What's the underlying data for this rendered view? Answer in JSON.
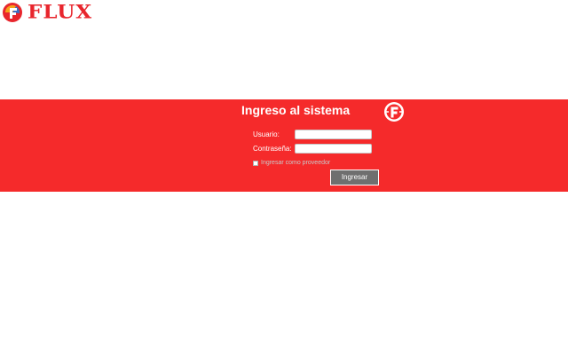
{
  "brand": {
    "name": "FLUX",
    "color": "#e8262d"
  },
  "colors": {
    "band": "#f52a2b",
    "button": "#6f6f6f"
  },
  "login": {
    "title": "Ingreso al sistema",
    "username_label": "Usuario:",
    "username_value": "",
    "password_label": "Contraseña:",
    "password_value": "",
    "provider_checkbox_label": "Ingresar como proveedor",
    "provider_checked": false,
    "submit_label": "Ingresar"
  },
  "icons": {
    "brand_logo": "flux-logo-icon",
    "title_badge": "flux-badge-icon"
  }
}
